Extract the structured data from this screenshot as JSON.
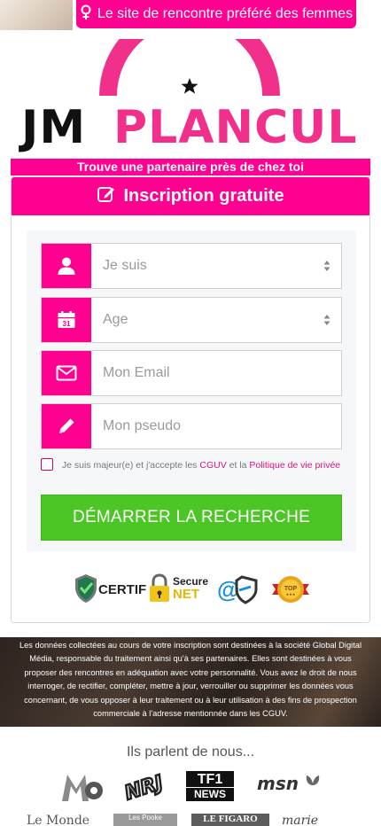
{
  "top_banner": {
    "text": "Le site de rencontre préféré des femmes",
    "icon": "female-symbol-icon"
  },
  "logo": {
    "word1": "JM",
    "word2": "PLANCUL"
  },
  "tagline": "Trouve une partenaire près de chez toi",
  "signup": {
    "title": "Inscription gratuite",
    "fields": [
      {
        "placeholder": "Je suis",
        "icon": "user-icon",
        "type": "select"
      },
      {
        "placeholder": "Age",
        "icon": "calendar-icon",
        "type": "select"
      },
      {
        "placeholder": "Mon Email",
        "icon": "envelope-icon",
        "type": "input"
      },
      {
        "placeholder": "Mon pseudo",
        "icon": "pencil-icon",
        "type": "input"
      }
    ],
    "consent": {
      "prefix": "Je suis majeur(e) et j'accepte les ",
      "cguv": "CGUV",
      "middle": " et la ",
      "policy": "Politique de vie privée"
    },
    "submit_label": "DÉMARRER LA RECHERCHE",
    "badges": {
      "certif": "CERTIF",
      "secure": "Secure",
      "net": "NET",
      "top": "TOP"
    }
  },
  "legal_text": "Les données collectées au cours de votre inscription sont destinées à la société Global Digital Média, responsable du traitement ainsi qu'à ses partenaires. Elles sont destinées à vous proposer des rencontres en adéquation avec votre personnalité. Vous avez le droit de nous interroger, de rectifier, compléter, mettre à jour, verrouiller ou supprimer les données vous concernant, de vous opposer à leur traitement ou à leur utilisation à des fins de prospection commerciale à l'adresse mentionnée dans les CGUV.",
  "press": {
    "title": "Ils parlent de nous...",
    "logos": {
      "m6": "M6",
      "nrj": "NRJ",
      "tf1_top": "TF1",
      "tf1_bottom": "NEWS",
      "msn": "msn",
      "lemonde": "Le Monde",
      "pt": "Les Pooke",
      "figaro": "LE FIGARO",
      "mc": "marie claire"
    }
  },
  "colors": {
    "brand_pink": "#ff0090",
    "logo_pink": "#f0308a",
    "cta_green": "#4cc624"
  }
}
